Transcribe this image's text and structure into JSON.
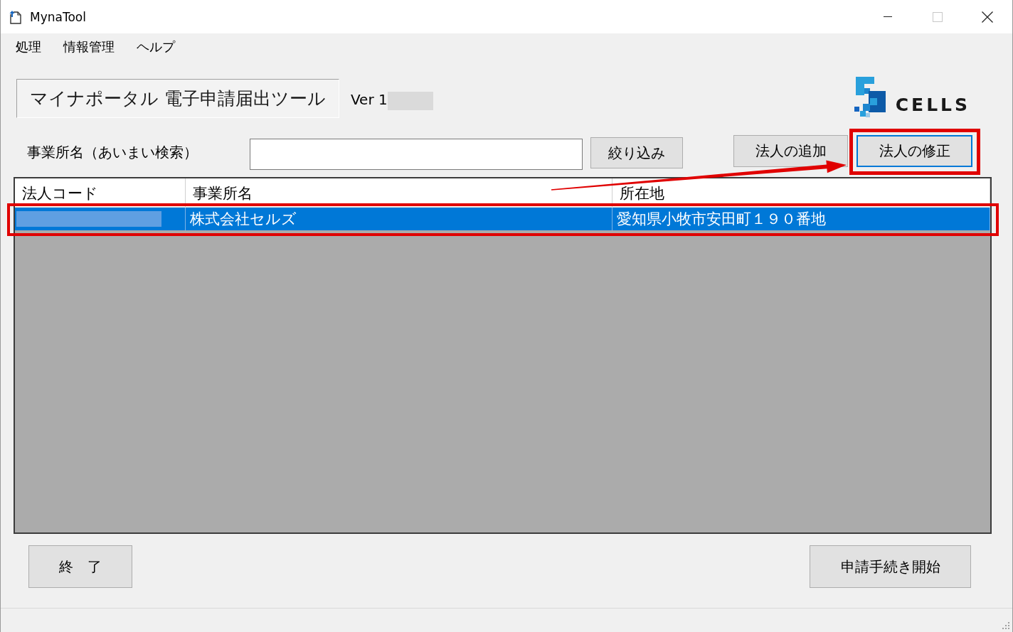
{
  "window": {
    "title": "MynaTool",
    "maximize_disabled": true
  },
  "menu": [
    {
      "label": "処理"
    },
    {
      "label": "情報管理"
    },
    {
      "label": "ヘルプ"
    }
  ],
  "header": {
    "title": "マイナポータル 電子申請届出ツール",
    "version": "Ver 1",
    "logo": "CELLS"
  },
  "search": {
    "label": "事業所名（あいまい検索）",
    "button": "絞り込み"
  },
  "actions": [
    {
      "label": "法人の追加",
      "focused": false
    },
    {
      "label": "法人の修正",
      "focused": true
    }
  ],
  "table": {
    "columns": [
      "法人コード",
      "事業所名",
      "所在地"
    ],
    "rows": [
      {
        "selected": true,
        "office_name": "株式会社セルズ",
        "address": "愛知県小牧市安田町１９０番地"
      }
    ]
  },
  "footer": [
    {
      "label": "終　了"
    },
    {
      "label": "申請手続き開始"
    }
  ]
}
